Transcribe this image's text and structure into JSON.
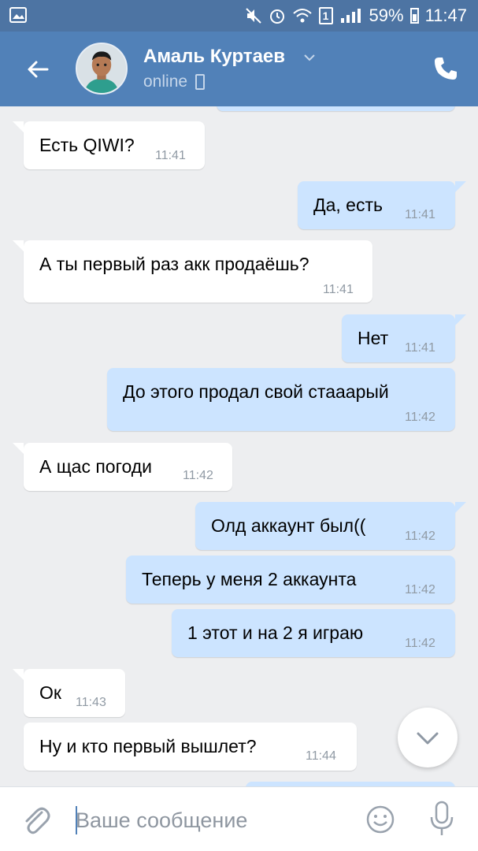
{
  "status_bar": {
    "battery_percent": "59%",
    "time": "11:47",
    "sim_label": "1"
  },
  "header": {
    "contact_name": "Амаль Куртаев",
    "status": "online"
  },
  "messages": [
    {
      "direction": "incoming",
      "text": "Есть QIWI?",
      "time": "11:41"
    },
    {
      "direction": "outgoing",
      "text": "Да, есть",
      "time": "11:41"
    },
    {
      "direction": "incoming",
      "text": "А ты первый раз акк продаёшь?",
      "time": "11:41"
    },
    {
      "direction": "outgoing",
      "text": "Нет",
      "time": "11:41"
    },
    {
      "direction": "outgoing",
      "text": "До этого продал свой стааарый",
      "time": "11:42"
    },
    {
      "direction": "incoming",
      "text": "А щас погоди",
      "time": "11:42"
    },
    {
      "direction": "outgoing",
      "text": "Олд аккаунт был((",
      "time": "11:42"
    },
    {
      "direction": "outgoing",
      "text": "Теперь у меня 2 аккаунта",
      "time": "11:42"
    },
    {
      "direction": "outgoing",
      "text": "1 этот и на 2 я играю",
      "time": "11:42"
    },
    {
      "direction": "incoming",
      "text": "Ок",
      "time": "11:43"
    },
    {
      "direction": "incoming",
      "text": "Ну и кто первый вышлет?",
      "time": "11:44"
    }
  ],
  "composer": {
    "placeholder": "Ваше сообщение"
  },
  "icons": {
    "back": "arrow-left-icon",
    "call": "phone-icon",
    "attach": "paperclip-icon",
    "emoji": "smile-icon",
    "mic": "microphone-icon",
    "scroll": "chevron-down-icon"
  },
  "colors": {
    "header": "#5181b8",
    "status_bar": "#4d74a3",
    "background": "#edeef0",
    "incoming_bubble": "#ffffff",
    "outgoing_bubble": "#cce4ff"
  }
}
